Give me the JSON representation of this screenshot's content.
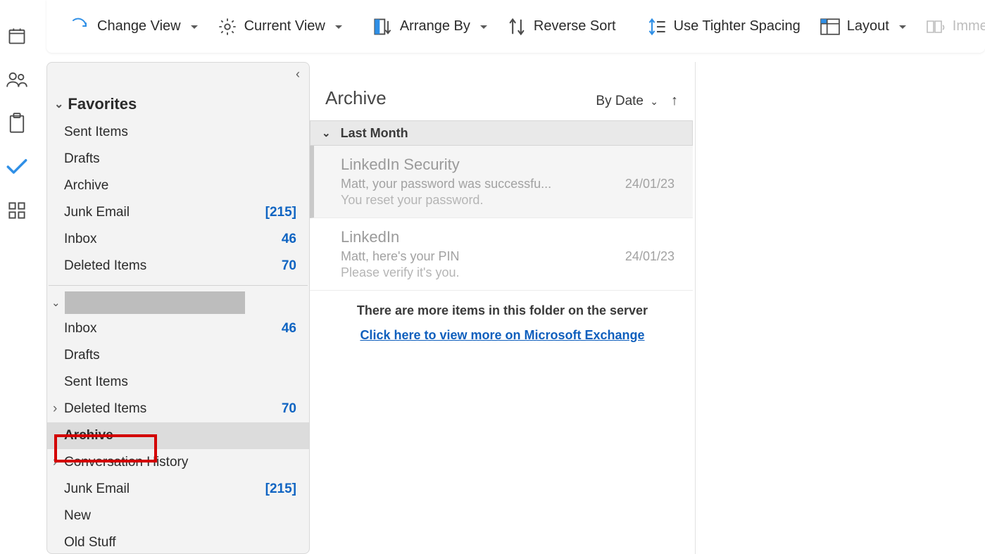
{
  "ribbon": {
    "change_view": "Change View",
    "current_view": "Current View",
    "arrange_by": "Arrange By",
    "reverse_sort": "Reverse Sort",
    "tighter_spacing": "Use Tighter Spacing",
    "layout": "Layout",
    "immersive": "Immers"
  },
  "favorites": {
    "title": "Favorites",
    "items": [
      {
        "label": "Sent Items",
        "count": ""
      },
      {
        "label": "Drafts",
        "count": ""
      },
      {
        "label": "Archive",
        "count": ""
      },
      {
        "label": "Junk Email",
        "count": "[215]"
      },
      {
        "label": "Inbox",
        "count": "46"
      },
      {
        "label": "Deleted Items",
        "count": "70"
      }
    ]
  },
  "account": {
    "items": [
      {
        "label": "Inbox",
        "count": "46"
      },
      {
        "label": "Drafts",
        "count": ""
      },
      {
        "label": "Sent Items",
        "count": ""
      },
      {
        "label": "Deleted Items",
        "count": "70"
      },
      {
        "label": "Archive",
        "count": ""
      },
      {
        "label": "Conversation History",
        "count": ""
      },
      {
        "label": "Junk Email",
        "count": "[215]"
      },
      {
        "label": "New",
        "count": ""
      },
      {
        "label": "Old Stuff",
        "count": ""
      }
    ]
  },
  "list": {
    "title": "Archive",
    "sort_label": "By Date",
    "group_label": "Last Month",
    "messages": [
      {
        "sender": "LinkedIn Security",
        "subject": "Matt, your password was successfu...",
        "date": "24/01/23",
        "preview": "You reset your password."
      },
      {
        "sender": "LinkedIn",
        "subject": "Matt, here's your PIN",
        "date": "24/01/23",
        "preview": "Please verify it's you."
      }
    ],
    "more_text": "There are more items in this folder on the server",
    "more_link": "Click here to view more on Microsoft Exchange"
  }
}
